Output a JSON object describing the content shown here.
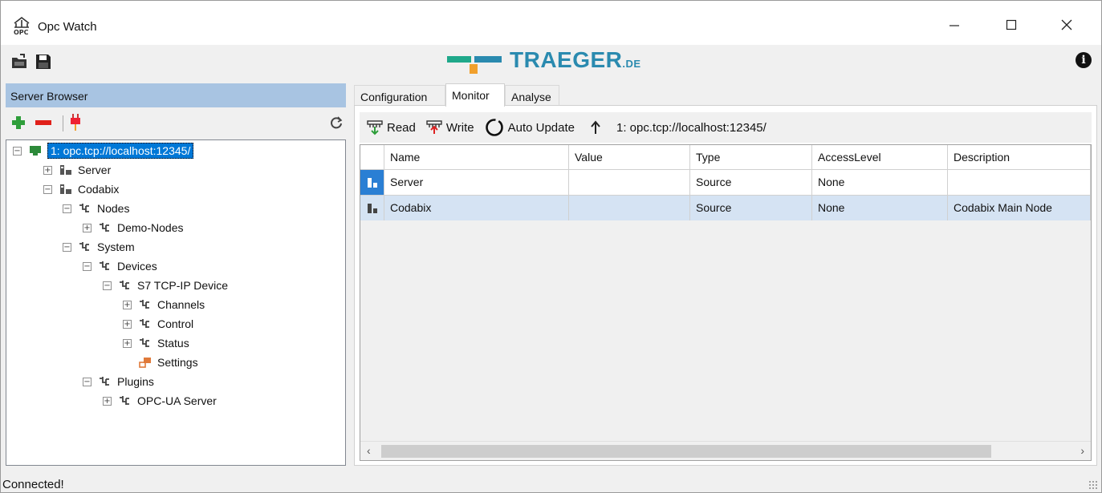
{
  "window": {
    "title": "Opc Watch"
  },
  "logo": {
    "text": "TRAEGER",
    "suffix": ".DE",
    "colors": {
      "teal": "#2a8aaf",
      "green": "#1fa88a",
      "orange": "#f1a02c"
    }
  },
  "left_panel": {
    "header": "Server Browser",
    "tree": [
      {
        "label": "1: opc.tcp://localhost:12345/",
        "toggle": "−",
        "icon": "server-connection-icon",
        "selected": true
      },
      {
        "label": "Server",
        "toggle": "+",
        "icon": "object-node-icon"
      },
      {
        "label": "Codabix",
        "toggle": "−",
        "icon": "object-node-icon"
      },
      {
        "label": "Nodes",
        "toggle": "−",
        "icon": "folder-node-icon"
      },
      {
        "label": "Demo-Nodes",
        "toggle": "+",
        "icon": "folder-node-icon"
      },
      {
        "label": "System",
        "toggle": "−",
        "icon": "folder-node-icon"
      },
      {
        "label": "Devices",
        "toggle": "−",
        "icon": "folder-node-icon"
      },
      {
        "label": "S7 TCP-IP Device",
        "toggle": "−",
        "icon": "folder-node-icon"
      },
      {
        "label": "Channels",
        "toggle": "+",
        "icon": "folder-node-icon"
      },
      {
        "label": "Control",
        "toggle": "+",
        "icon": "folder-node-icon"
      },
      {
        "label": "Status",
        "toggle": "+",
        "icon": "folder-node-icon"
      },
      {
        "label": "Settings",
        "toggle": "",
        "icon": "settings-node-icon"
      },
      {
        "label": "Plugins",
        "toggle": "−",
        "icon": "folder-node-icon"
      },
      {
        "label": "OPC-UA Server",
        "toggle": "+",
        "icon": "folder-node-icon"
      }
    ]
  },
  "tabs": [
    {
      "label": "Configuration"
    },
    {
      "label": "Monitor",
      "active": true
    },
    {
      "label": "Analyse"
    }
  ],
  "monitor_toolbar": {
    "read_label": "Read",
    "write_label": "Write",
    "auto_update_label": "Auto Update",
    "endpoint": "1: opc.tcp://localhost:12345/"
  },
  "grid": {
    "columns": [
      "Name",
      "Value",
      "Type",
      "AccessLevel",
      "Description"
    ],
    "rows": [
      {
        "name": "Server",
        "value": "",
        "type": "Source",
        "access_level": "None",
        "description": ""
      },
      {
        "name": "Codabix",
        "value": "",
        "type": "Source",
        "access_level": "None",
        "description": "Codabix Main Node"
      }
    ]
  },
  "status": {
    "text": "Connected!"
  }
}
